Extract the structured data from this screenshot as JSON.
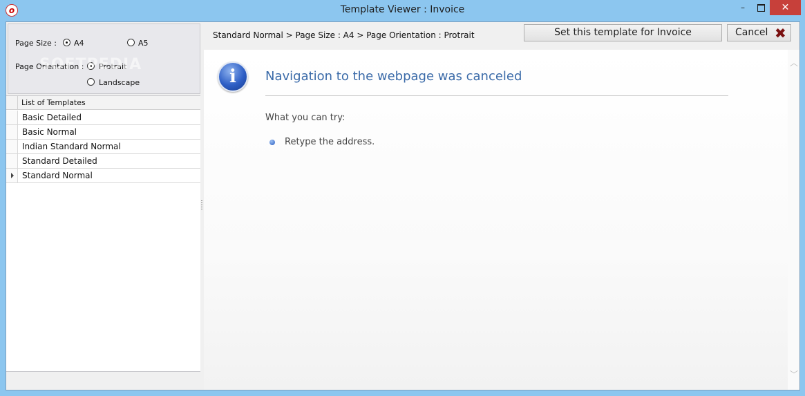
{
  "window": {
    "title": "Template Viewer : Invoice",
    "icon_name": "app-logo-icon",
    "controls": {
      "minimize": "–",
      "close": "✕"
    }
  },
  "options": {
    "page_size_label": "Page Size :",
    "page_size_options": [
      {
        "label": "A4",
        "checked": true
      },
      {
        "label": "A5",
        "checked": false
      }
    ],
    "orientation_label": "Page Orientation :",
    "orientation_options": [
      {
        "label": "Protrait",
        "checked": true
      },
      {
        "label": "Landscape",
        "checked": false
      }
    ],
    "watermark": "SOFTPEDIA"
  },
  "templates": {
    "header": "List of Templates",
    "rows": [
      "Basic Detailed",
      "Basic Normal",
      "Indian Standard Normal",
      "Standard Detailed",
      "Standard Normal"
    ],
    "selected_index": 4
  },
  "toolbar": {
    "breadcrumb": "Standard Normal > Page Size : A4 > Page Orientation : Protrait",
    "set_template_label": "Set this template for Invoice",
    "cancel_label": "Cancel",
    "cancel_icon": "✖"
  },
  "browser": {
    "error_title": "Navigation to the webpage was canceled",
    "try_label": "What you can try:",
    "suggestions": [
      "Retype the address."
    ],
    "icon_name": "info-icon",
    "accent_color": "#3a6aa8"
  }
}
